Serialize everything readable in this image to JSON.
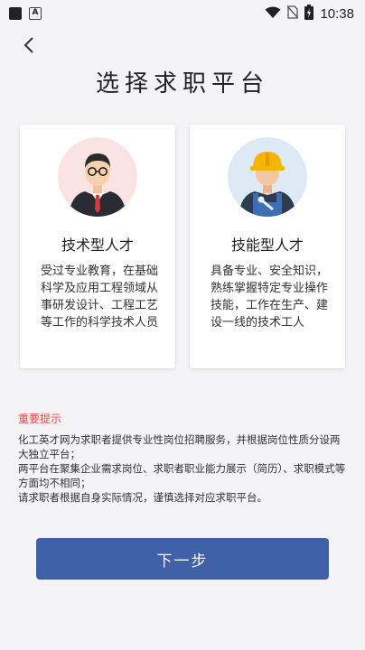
{
  "status_bar": {
    "time": "10:38",
    "left_icons": [
      "square-icon",
      "a-notification-icon"
    ],
    "right_icons": [
      "wifi-icon",
      "no-sim-icon",
      "battery-charging-icon"
    ]
  },
  "header": {
    "back_icon": "chevron-left-icon",
    "title": "选择求职平台"
  },
  "cards": [
    {
      "title": "技术型人才",
      "avatar": "business-man-avatar",
      "description": "受过专业教育，在基础科学及应用工程领域从事研发设计、工程工艺等工作的科学技术人员"
    },
    {
      "title": "技能型人才",
      "avatar": "worker-helmet-avatar",
      "description": "具备专业、安全知识，熟练掌握特定专业操作技能，工作在生产、建设一线的技术工人"
    }
  ],
  "notice": {
    "title": "重要提示",
    "lines": [
      "化工英才网为求职者提供专业性岗位招聘服务，并根据岗位性质分设两大独立平台；",
      "两平台在聚集企业需求岗位、求职者职业能力展示（简历）、求职模式等方面均不相同；",
      "请求职者根据自身实际情况，谨慎选择对应求职平台。"
    ]
  },
  "next_button": {
    "label": "下一步"
  },
  "colors": {
    "accent": "#4060a8",
    "notice_red": "#e24a4a",
    "background": "#f4f4f6"
  }
}
